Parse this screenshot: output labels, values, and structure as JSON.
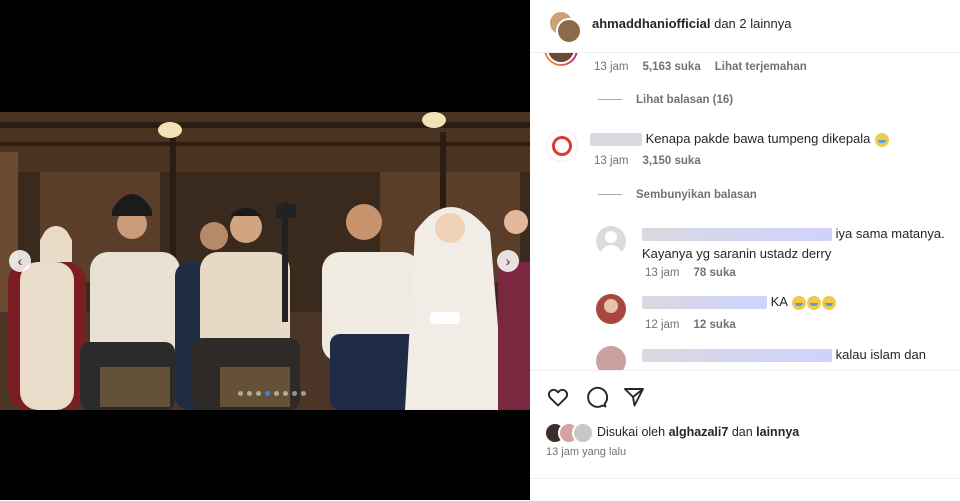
{
  "post": {
    "header": {
      "username": "ahmaddhaniofficial",
      "suffix": "dan 2 lainnya"
    }
  },
  "comments": {
    "first_meta": {
      "time": "13 jam",
      "likes": "5,163 suka",
      "translate": "Lihat terjemahan"
    },
    "view_replies": "Lihat balasan (16)",
    "c2": {
      "text": "Kenapa pakde bawa tumpeng dikepala",
      "time": "13 jam",
      "likes": "3,150 suka"
    },
    "hide_replies": "Sembunyikan balasan",
    "r1": {
      "text_a": "iya sama matanya.",
      "text_b": "Kayanya yg saranin ustadz derry",
      "time": "13 jam",
      "likes": "78 suka"
    },
    "r2": {
      "text": "KA",
      "time": "12 jam",
      "likes": "12 suka"
    },
    "r3": {
      "text": "kalau islam dan"
    }
  },
  "footer": {
    "liked_prefix": "Disukai oleh",
    "liked_user": "alghazali7",
    "liked_join": "dan",
    "liked_others": "lainnya",
    "posted_time": "13 jam yang lalu"
  },
  "colors": {
    "accent": "#3b82f6",
    "text": "#262626",
    "muted": "#737373"
  },
  "icons": [
    "heart-icon",
    "comment-icon",
    "share-icon",
    "chevron-left-icon",
    "chevron-right-icon"
  ]
}
